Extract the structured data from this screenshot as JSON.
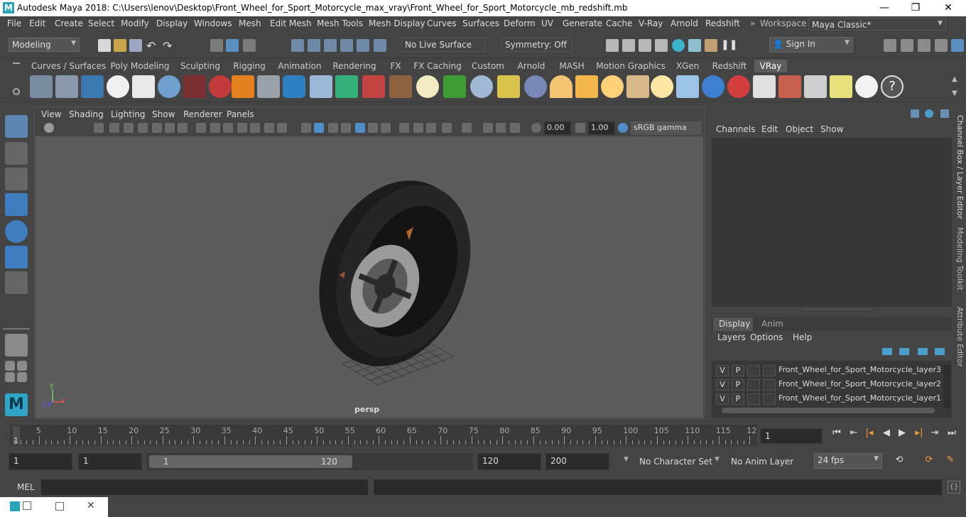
{
  "window": {
    "title": "Autodesk Maya 2018: C:\\Users\\lenov\\Desktop\\Front_Wheel_for_Sport_Motorcycle_max_vray\\Front_Wheel_for_Sport_Motorcycle_mb_redshift.mb",
    "logo": "M",
    "minimize": "—",
    "maximize": "❐",
    "close": "✕"
  },
  "menubar": {
    "items": [
      "File",
      "Edit",
      "Create",
      "Select",
      "Modify",
      "Display",
      "Windows",
      "Mesh",
      "Edit Mesh",
      "Mesh Tools",
      "Mesh Display",
      "Curves",
      "Surfaces",
      "Deform",
      "UV",
      "Generate",
      "Cache",
      "V-Ray",
      "Arnold",
      "Redshift"
    ],
    "workspace_label": "Workspace :",
    "workspace_value": "Maya Classic*"
  },
  "statusline": {
    "mode": "Modeling",
    "live_surface": "No Live Surface",
    "symmetry": "Symmetry: Off",
    "sign_in": "Sign In"
  },
  "shelf": {
    "tabs": [
      "Curves / Surfaces",
      "Poly Modeling",
      "Sculpting",
      "Rigging",
      "Animation",
      "Rendering",
      "FX",
      "FX Caching",
      "Custom",
      "Arnold",
      "MASH",
      "Motion Graphics",
      "XGen",
      "Redshift",
      "VRay"
    ],
    "active_tab": "VRay"
  },
  "viewport": {
    "menu": [
      "View",
      "Shading",
      "Lighting",
      "Show",
      "Renderer",
      "Panels"
    ],
    "exposure": "0.00",
    "gamma": "1.00",
    "color_space": "sRGB gamma",
    "camera_label": "persp",
    "axis_y": "y",
    "axis_x": "x",
    "axis_z": "z"
  },
  "channelbox": {
    "menu": [
      "Channels",
      "Edit",
      "Object",
      "Show"
    ]
  },
  "layereditor": {
    "tabs": [
      "Display",
      "Anim"
    ],
    "active_tab": "Display",
    "menu": [
      "Layers",
      "Options",
      "Help"
    ],
    "layers": [
      {
        "v": "V",
        "p": "P",
        "name": "Front_Wheel_for_Sport_Motorcycle_layer3"
      },
      {
        "v": "V",
        "p": "P",
        "name": "Front_Wheel_for_Sport_Motorcycle_layer2"
      },
      {
        "v": "V",
        "p": "P",
        "name": "Front_Wheel_for_Sport_Motorcycle_layer1"
      }
    ]
  },
  "sidetabs": [
    "Channel Box / Layer Editor",
    "Modeling Toolkit",
    "Attribute Editor"
  ],
  "timeline": {
    "ticks": [
      "5",
      "10",
      "15",
      "20",
      "25",
      "30",
      "35",
      "40",
      "45",
      "50",
      "55",
      "60",
      "65",
      "70",
      "75",
      "80",
      "85",
      "90",
      "95",
      "100",
      "105",
      "110",
      "115",
      "12"
    ],
    "current_marker": "1",
    "current_frame": "1"
  },
  "range": {
    "start": "1",
    "playback_start": "1",
    "slider_start": "1",
    "slider_end": "120",
    "playback_end": "120",
    "end": "200",
    "character_set": "No Character Set",
    "anim_layer": "No Anim Layer",
    "fps": "24 fps"
  },
  "cmdline": {
    "label": "MEL"
  }
}
